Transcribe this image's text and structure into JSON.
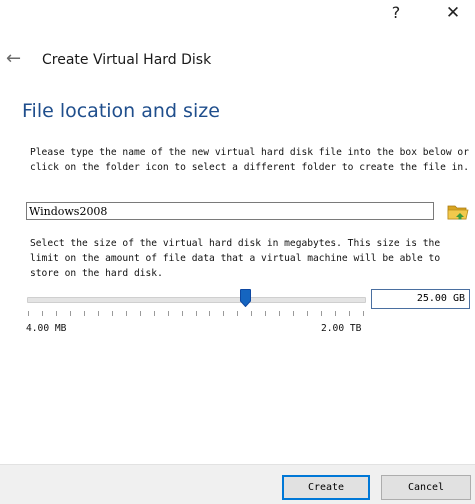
{
  "titlebar": {
    "help_glyph": "?",
    "close_glyph": "✕"
  },
  "dialog": {
    "back_glyph": "←",
    "title": "Create Virtual Hard Disk",
    "section_title": "File location and size",
    "location_description": "Please type the name of the new virtual hard disk file into the box below or click on the folder icon to select a different folder to create the file in.",
    "file_name": "Windows2008",
    "size_description": "Select the size of the virtual hard disk in megabytes. This size is the limit on the amount of file data that a virtual machine will be able to store on the hard disk.",
    "size_value": "25.00 GB",
    "slider_fraction": 0.65,
    "range_min": "4.00 MB",
    "range_max": "2.00 TB"
  },
  "buttons": {
    "create": "Create",
    "cancel": "Cancel"
  },
  "icons": {
    "folder": "folder-icon",
    "back": "back-arrow-icon",
    "help": "help-icon",
    "close": "close-icon"
  },
  "colors": {
    "accent": "#1f4e8c",
    "slider_handle": "#1565c0",
    "default_button_border": "#0078d7"
  }
}
